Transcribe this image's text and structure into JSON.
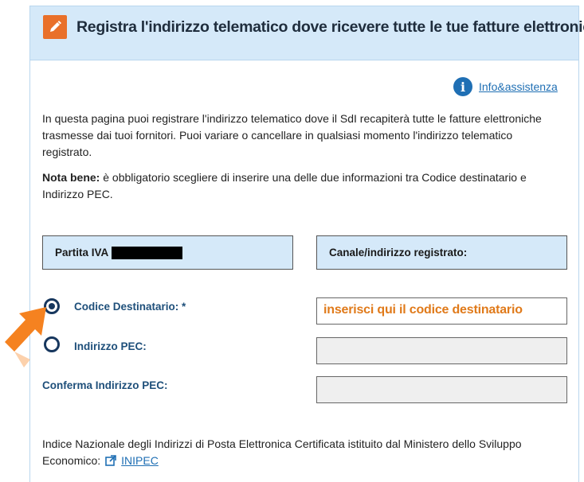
{
  "header": {
    "title": "Registra l'indirizzo telematico dove ricevere tutte le tue fatture elettroniche",
    "icon": "pencil-icon",
    "accent_color": "#e9702a"
  },
  "info_link": {
    "label": "Info&assistenza",
    "icon": "info-icon"
  },
  "intro": {
    "text": "In questa pagina puoi registrare l'indirizzo telematico dove il SdI recapiterà tutte le fatture elettroniche trasmesse dai tuoi fornitori. Puoi variare o cancellare in qualsiasi momento l'indirizzo telematico registrato."
  },
  "note": {
    "label": "Nota bene:",
    "text": " è obbligatorio scegliere di inserire una delle due informazioni tra Codice destinatario e Indirizzo PEC."
  },
  "boxes": {
    "partita_iva_label": "Partita IVA",
    "canale_label": "Canale/indirizzo registrato:"
  },
  "form": {
    "codice_label": "Codice Destinatario: *",
    "codice_value": "inserisci qui il codice destinatario",
    "codice_selected": true,
    "pec_label": "Indirizzo PEC:",
    "pec_value": "",
    "conferma_label": "Conferma Indirizzo PEC:",
    "conferma_value": ""
  },
  "footer": {
    "text": "Indice Nazionale degli Indirizzi di Posta Elettronica Certificata istituito dal Ministero dello Sviluppo Economico:",
    "link_label": "INIPEC",
    "link_icon": "external-link-icon"
  },
  "annotation": {
    "icon": "arrow-pointer-icon",
    "color": "#f58220"
  }
}
